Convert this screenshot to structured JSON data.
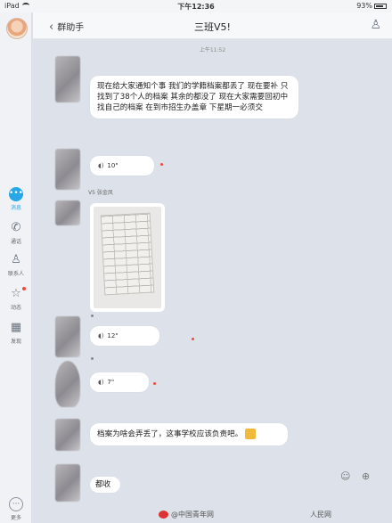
{
  "status_bar": {
    "device": "iPad",
    "time": "下午12:36",
    "battery": "93%"
  },
  "sidebar": {
    "items": [
      {
        "label": "消息",
        "icon": "message-bubble-icon",
        "active": true
      },
      {
        "label": "通话",
        "icon": "phone-icon"
      },
      {
        "label": "联系人",
        "icon": "contacts-icon"
      },
      {
        "label": "动态",
        "icon": "star-icon"
      },
      {
        "label": "发现",
        "icon": "grid-icon"
      }
    ],
    "more_label": "更多"
  },
  "header": {
    "back_label": "群助手",
    "title": "三班V5!"
  },
  "chat": {
    "timestamp": "上午11:52",
    "messages": [
      {
        "type": "text",
        "text": "现在给大家通知个事  我们的学籍档案都丢了  现在要补  只找到了38个人的档案  其余的都没了  现在大家需要回初中找自己的档案  在到市招生办盖章  下星期一必须交"
      },
      {
        "type": "voice",
        "duration": "10\""
      },
      {
        "type": "image",
        "sender": "V5 张金凤"
      },
      {
        "type": "voice",
        "duration": "12\""
      },
      {
        "type": "voice",
        "duration": "7\""
      },
      {
        "type": "text",
        "text": "档案为啥会弄丢了，这事学校应该负责吧。"
      },
      {
        "type": "text",
        "text": "都收"
      }
    ]
  },
  "watermarks": [
    "@中国青年网",
    "人民网"
  ]
}
